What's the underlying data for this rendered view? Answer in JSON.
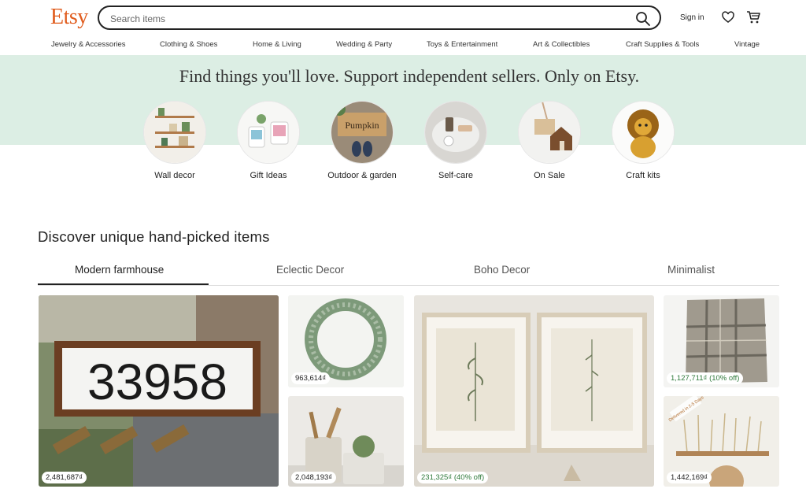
{
  "header": {
    "logo": "Etsy",
    "search_placeholder": "Search items",
    "sign_in": "Sign in"
  },
  "nav": [
    "Jewelry & Accessories",
    "Clothing & Shoes",
    "Home & Living",
    "Wedding & Party",
    "Toys & Entertainment",
    "Art & Collectibles",
    "Craft Supplies & Tools",
    "Vintage"
  ],
  "hero": {
    "title": "Find things you'll love. Support independent sellers. Only on Etsy."
  },
  "categories": [
    "Wall decor",
    "Gift Ideas",
    "Outdoor & garden",
    "Self-care",
    "On Sale",
    "Craft kits"
  ],
  "discover": {
    "title": "Discover unique hand-picked items",
    "tabs": [
      "Modern farmhouse",
      "Eclectic Decor",
      "Boho Decor",
      "Minimalist"
    ]
  },
  "items": [
    {
      "price": "2,481,687₫",
      "sale": false
    },
    {
      "price": "963,614₫",
      "sale": false
    },
    {
      "price": "2,048,193₫",
      "sale": false
    },
    {
      "price": "231,325₫ (40% off)",
      "sale": true
    },
    {
      "price": "1,127,711₫ (10% off)",
      "sale": true
    },
    {
      "price": "1,442,169₫",
      "sale": false
    }
  ],
  "tiles": {
    "house_number": "33958",
    "delivered_badge": "Delivered in 2-5 Days"
  },
  "colors": {
    "brand": "#e05b1c",
    "hero_bg": "#dceee4",
    "sale_text": "#2f7a3b"
  }
}
